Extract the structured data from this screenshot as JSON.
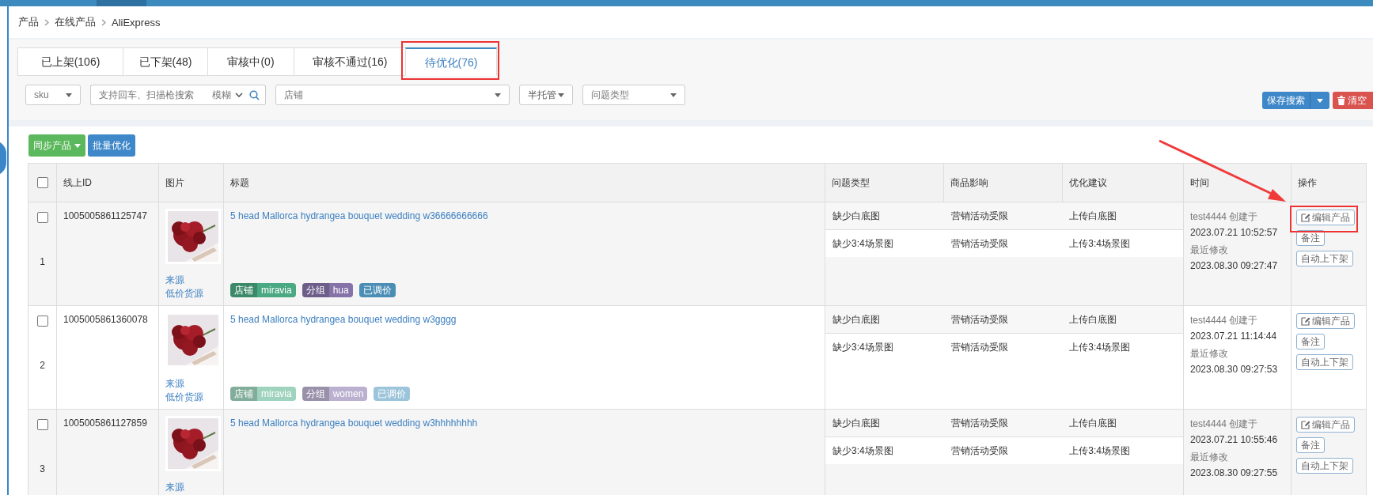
{
  "breadcrumb": [
    "产品",
    "在线产品",
    "AliExpress"
  ],
  "tabs": [
    {
      "label": "已上架(106)",
      "selected": false
    },
    {
      "label": "已下架(48)",
      "selected": false
    },
    {
      "label": "审核中(0)",
      "selected": false
    },
    {
      "label": "审核不通过(16)",
      "selected": false
    },
    {
      "label": "待优化(76)",
      "selected": true
    }
  ],
  "filters": {
    "field_select": "sku",
    "search_placeholder": "支持回车、扫描枪搜索",
    "match_select": "模糊",
    "shop_placeholder": "店铺",
    "mode_select": "半托管",
    "issue_type_placeholder": "问题类型"
  },
  "search_actions": [
    {
      "label": "保存搜索",
      "kind": "split"
    },
    {
      "label": "清空",
      "kind": "danger"
    }
  ],
  "toolbar": [
    {
      "label": "同步产品",
      "kind": "dropdown"
    },
    {
      "label": "批量优化",
      "kind": "primary"
    }
  ],
  "table": {
    "select_all_checked": false,
    "columns": [
      "线上ID",
      "图片",
      "标题",
      "问题类型",
      "商品影响",
      "优化建议",
      "时间",
      "操作"
    ],
    "rows": [
      {
        "checked": false,
        "number": "1",
        "id": "1005005861125747",
        "sources": [
          "来源",
          "低价货源"
        ],
        "title": "5 head Mallorca hydrangea bouquet wedding w36666666666",
        "tags": [
          {
            "kind": "pair",
            "label": "店铺",
            "value": "miravia",
            "color": "#4aa882"
          },
          {
            "kind": "pair",
            "label": "分组",
            "value": "hua",
            "color": "#8472a8"
          },
          {
            "kind": "single",
            "label": "已调价",
            "color": "#4a8db5"
          }
        ],
        "issues": [
          {
            "type": "缺少白底图",
            "impact": "营销活动受限",
            "suggestion": "上传白底图"
          },
          {
            "type": "缺少3:4场景图",
            "impact": "营销活动受限",
            "suggestion": "上传3:4场景图"
          }
        ],
        "created_by": "test4444 创建于",
        "created_at": "2023.07.21 10:52:57",
        "modified_label": "最近修改",
        "modified_at": "2023.08.30 09:27:47",
        "actions": [
          {
            "label": "编辑产品",
            "kind": "edit"
          },
          {
            "label": "备注",
            "kind": "plain"
          },
          {
            "label": "自动上下架",
            "kind": "plain"
          }
        ]
      },
      {
        "checked": false,
        "number": "2",
        "id": "1005005861360078",
        "sources": [
          "来源",
          "低价货源"
        ],
        "title": "5 head Mallorca hydrangea bouquet wedding w3gggg",
        "tags": [
          {
            "kind": "pair",
            "label": "店铺",
            "value": "miravia",
            "color": "#9fd3bd"
          },
          {
            "kind": "pair",
            "label": "分组",
            "value": "women",
            "color": "#bbb0d0"
          },
          {
            "kind": "single",
            "label": "已调价",
            "color": "#9cc4da"
          }
        ],
        "issues": [
          {
            "type": "缺少白底图",
            "impact": "营销活动受限",
            "suggestion": "上传白底图"
          },
          {
            "type": "缺少3:4场景图",
            "impact": "营销活动受限",
            "suggestion": "上传3:4场景图"
          }
        ],
        "created_by": "test4444 创建于",
        "created_at": "2023.07.21 11:14:44",
        "modified_label": "最近修改",
        "modified_at": "2023.08.30 09:27:53",
        "actions": [
          {
            "label": "编辑产品",
            "kind": "edit"
          },
          {
            "label": "备注",
            "kind": "plain"
          },
          {
            "label": "自动上下架",
            "kind": "plain"
          }
        ]
      },
      {
        "checked": false,
        "number": "3",
        "id": "1005005861127859",
        "sources": [
          "来源"
        ],
        "title": "5 head Mallorca hydrangea bouquet wedding w3hhhhhhhh",
        "issues": [
          {
            "type": "缺少白底图",
            "impact": "营销活动受限",
            "suggestion": "上传白底图"
          },
          {
            "type": "缺少3:4场景图",
            "impact": "营销活动受限",
            "suggestion": "上传3:4场景图"
          }
        ],
        "created_by": "test4444 创建于",
        "created_at": "2023.07.21 10:55:46",
        "modified_label": "最近修改",
        "modified_at": "2023.08.30 09:27:55",
        "actions": [
          {
            "label": "编辑产品",
            "kind": "edit"
          },
          {
            "label": "备注",
            "kind": "plain"
          },
          {
            "label": "自动上下架",
            "kind": "plain"
          }
        ]
      }
    ]
  },
  "annotations": [
    {
      "kind": "box"
    },
    {
      "kind": "box"
    },
    {
      "kind": "arrow"
    }
  ]
}
